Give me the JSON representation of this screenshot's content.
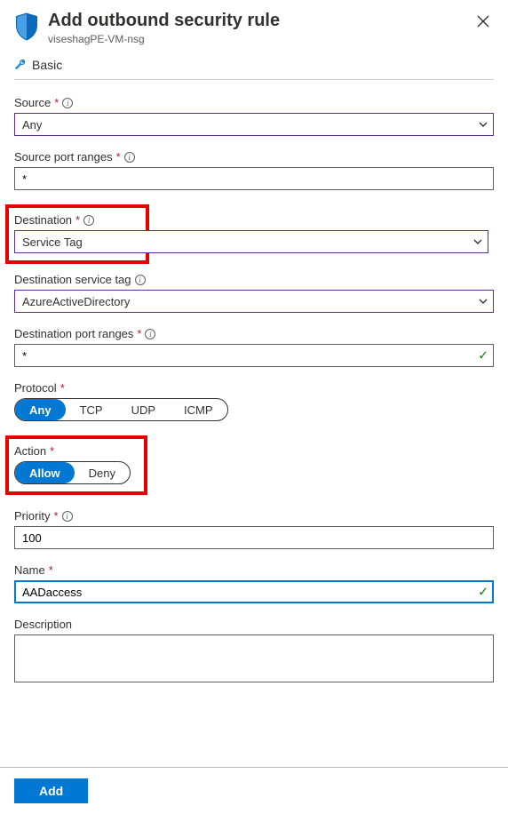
{
  "header": {
    "title": "Add outbound security rule",
    "subtitle": "viseshagPE-VM-nsg",
    "basic": "Basic"
  },
  "source": {
    "label": "Source",
    "value": "Any"
  },
  "sourcePortRanges": {
    "label": "Source port ranges",
    "value": "*"
  },
  "destination": {
    "label": "Destination",
    "value": "Service Tag"
  },
  "destinationServiceTag": {
    "label": "Destination service tag",
    "value": "AzureActiveDirectory"
  },
  "destinationPortRanges": {
    "label": "Destination port ranges",
    "value": "*"
  },
  "protocol": {
    "label": "Protocol",
    "options": [
      "Any",
      "TCP",
      "UDP",
      "ICMP"
    ],
    "selected": "Any"
  },
  "action": {
    "label": "Action",
    "options": [
      "Allow",
      "Deny"
    ],
    "selected": "Allow"
  },
  "priority": {
    "label": "Priority",
    "value": "100"
  },
  "name": {
    "label": "Name",
    "value": "AADaccess"
  },
  "description": {
    "label": "Description",
    "value": ""
  },
  "footer": {
    "add": "Add"
  }
}
